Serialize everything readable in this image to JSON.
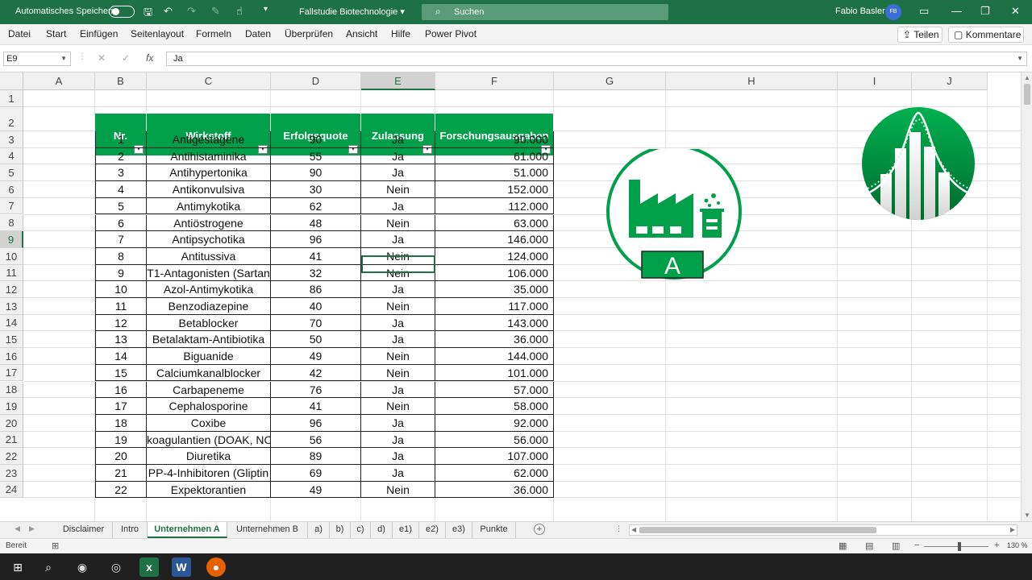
{
  "titlebar": {
    "autosave_label": "Automatisches Speichern",
    "filename": "Fallstudie Biotechnologie",
    "search_placeholder": "Suchen",
    "user_name": "Fabio Basler",
    "user_initials": "FB"
  },
  "menu": {
    "items": [
      "Datei",
      "Start",
      "Einfügen",
      "Seitenlayout",
      "Formeln",
      "Daten",
      "Überprüfen",
      "Ansicht",
      "Hilfe",
      "Power Pivot"
    ],
    "share_label": "Teilen",
    "comments_label": "Kommentare"
  },
  "formula_bar": {
    "name_box": "E9",
    "formula": "Ja"
  },
  "columns": [
    "A",
    "B",
    "C",
    "D",
    "E",
    "F",
    "G",
    "H",
    "I",
    "J"
  ],
  "rows": [
    "1",
    "2",
    "3",
    "4",
    "5",
    "6",
    "7",
    "8",
    "9",
    "10",
    "11",
    "12",
    "13",
    "14",
    "15",
    "16",
    "17",
    "18",
    "19",
    "20",
    "21",
    "22",
    "23",
    "24"
  ],
  "table": {
    "headers": [
      "Nr.",
      "Wirkstoff",
      "Erfolgsquote",
      "Zulassung",
      "Forschungsausgaben"
    ],
    "rows": [
      [
        "1",
        "Antigestagene",
        "90",
        "Ja",
        "90.000"
      ],
      [
        "2",
        "Antihistaminika",
        "55",
        "Ja",
        "61.000"
      ],
      [
        "3",
        "Antihypertonika",
        "90",
        "Ja",
        "51.000"
      ],
      [
        "4",
        "Antikonvulsiva",
        "30",
        "Nein",
        "152.000"
      ],
      [
        "5",
        "Antimykotika",
        "62",
        "Ja",
        "112.000"
      ],
      [
        "6",
        "Antiöstrogene",
        "48",
        "Nein",
        "63.000"
      ],
      [
        "7",
        "Antipsychotika",
        "96",
        "Ja",
        "146.000"
      ],
      [
        "8",
        "Antitussiva",
        "41",
        "Nein",
        "124.000"
      ],
      [
        "9",
        "T1-Antagonisten (Sartan",
        "32",
        "Nein",
        "106.000"
      ],
      [
        "10",
        "Azol-Antimykotika",
        "86",
        "Ja",
        "35.000"
      ],
      [
        "11",
        "Benzodiazepine",
        "40",
        "Nein",
        "117.000"
      ],
      [
        "12",
        "Betablocker",
        "70",
        "Ja",
        "143.000"
      ],
      [
        "13",
        "Betalaktam-Antibiotika",
        "50",
        "Ja",
        "36.000"
      ],
      [
        "14",
        "Biguanide",
        "49",
        "Nein",
        "144.000"
      ],
      [
        "15",
        "Calciumkanalblocker",
        "42",
        "Nein",
        "101.000"
      ],
      [
        "16",
        "Carbapeneme",
        "76",
        "Ja",
        "57.000"
      ],
      [
        "17",
        "Cephalosporine",
        "41",
        "Nein",
        "58.000"
      ],
      [
        "18",
        "Coxibe",
        "96",
        "Ja",
        "92.000"
      ],
      [
        "19",
        "koagulantien (DOAK, NO",
        "56",
        "Ja",
        "56.000"
      ],
      [
        "20",
        "Diuretika",
        "89",
        "Ja",
        "107.000"
      ],
      [
        "21",
        "PP-4-Inhibitoren (Gliptin",
        "69",
        "Ja",
        "62.000"
      ],
      [
        "22",
        "Expektorantien",
        "49",
        "Nein",
        "36.000"
      ]
    ]
  },
  "logo_a_letter": "A",
  "sheet_tabs": [
    "Disclaimer",
    "Intro",
    "Unternehmen A",
    "Unternehmen B",
    "a)",
    "b)",
    "c)",
    "d)",
    "e1)",
    "e2)",
    "e3)",
    "Punkte"
  ],
  "active_sheet": "Unternehmen A",
  "status": {
    "ready": "Bereit",
    "zoom": "130 %"
  },
  "colors": {
    "excel_green": "#1e7145",
    "table_header": "#00a04a"
  }
}
